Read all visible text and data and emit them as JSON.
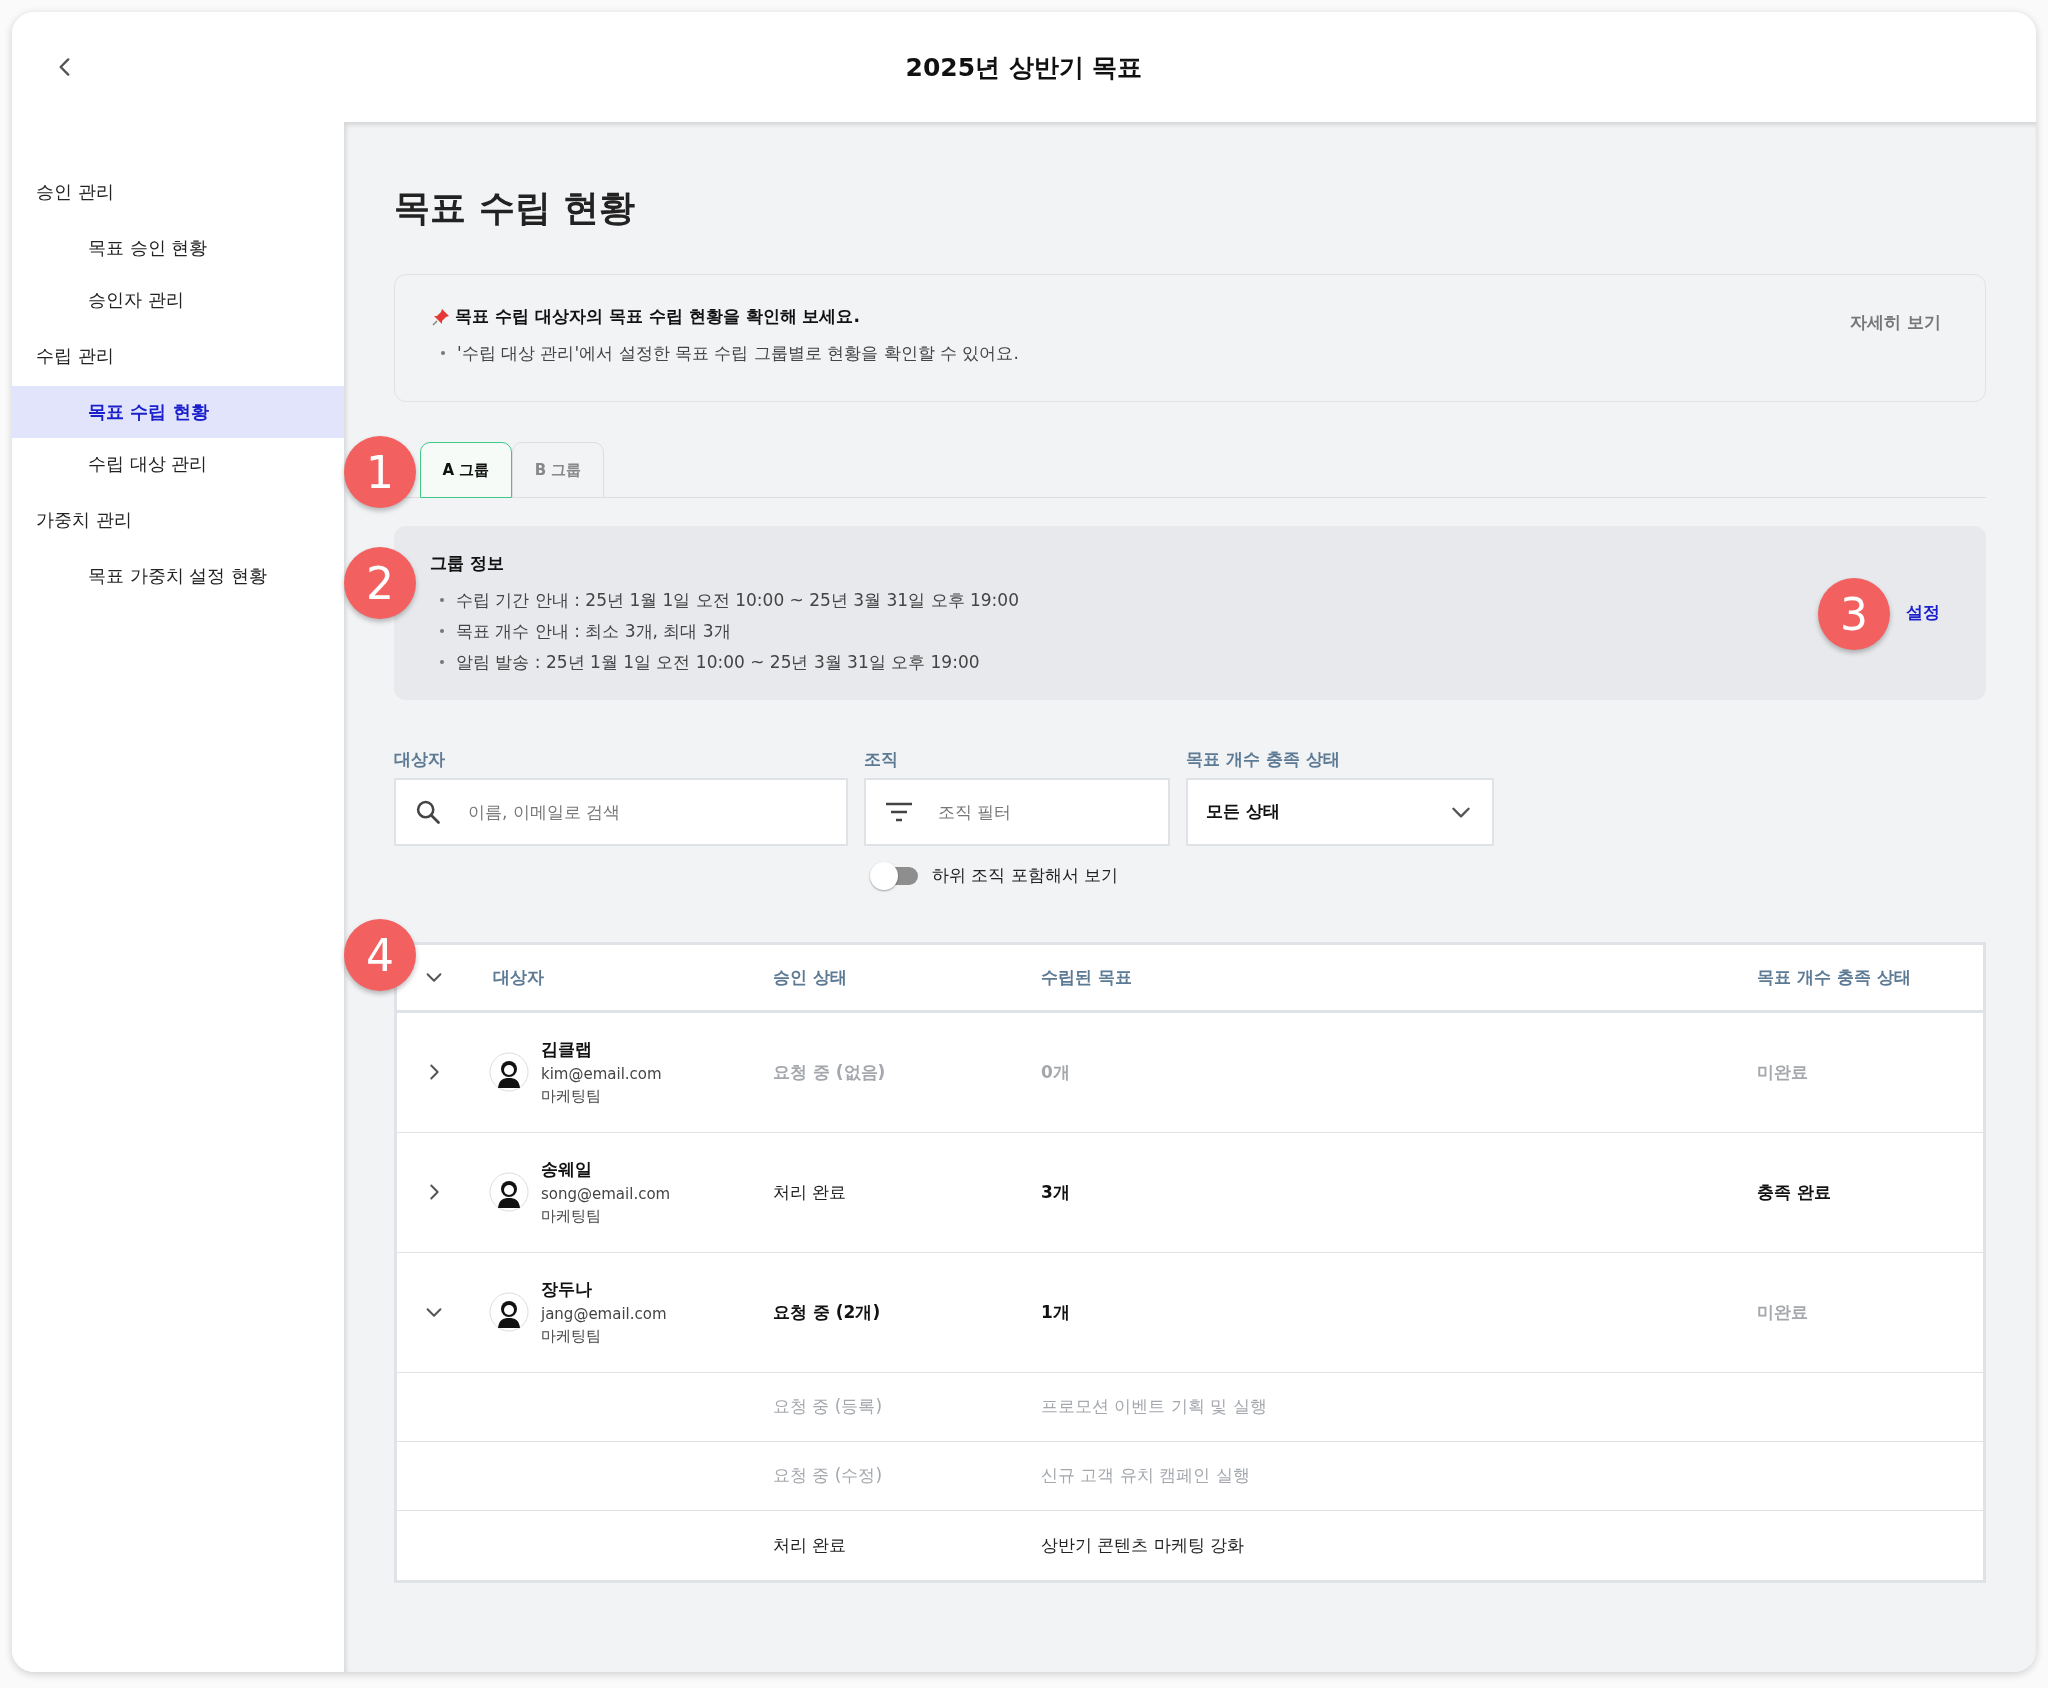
{
  "window": {
    "title": "2025년 상반기 목표"
  },
  "sidebar": {
    "sections": [
      {
        "label": "승인 관리",
        "children": [
          {
            "label": "목표 승인 현황",
            "selected": false
          },
          {
            "label": "승인자 관리",
            "selected": false
          }
        ]
      },
      {
        "label": "수립 관리",
        "children": [
          {
            "label": "목표 수립 현황",
            "selected": true
          },
          {
            "label": "수립 대상 관리",
            "selected": false
          }
        ]
      },
      {
        "label": "가중치 관리",
        "children": [
          {
            "label": "목표 가중치 설정 현황",
            "selected": false
          }
        ]
      }
    ]
  },
  "page_title": "목표 수립 현황",
  "notice": {
    "heading": "목표 수립 대상자의 목표 수립 현황을 확인해 보세요.",
    "bullets": [
      "'수립 대상 관리'에서 설정한 목표 수립 그룹별로 현황을 확인할 수 있어요."
    ],
    "link": "자세히 보기"
  },
  "tabs": [
    {
      "label": "A 그룹",
      "selected": true
    },
    {
      "label": "B 그룹",
      "selected": false
    }
  ],
  "group_info": {
    "heading": "그룹 정보",
    "bullets": [
      "수립 기간 안내 : 25년 1월 1일 오전 10:00 ~ 25년 3월 31일 오후 19:00",
      "목표 개수 안내 : 최소 3개, 최대 3개",
      "알림 발송 : 25년 1월 1일 오전 10:00 ~ 25년 3월 31일 오후 19:00"
    ],
    "link": "설정"
  },
  "filters": {
    "target": {
      "label": "대상자",
      "placeholder": "이름, 이메일로 검색"
    },
    "org": {
      "label": "조직",
      "placeholder": "조직 필터"
    },
    "status": {
      "label": "목표 개수 충족 상태",
      "value": "모든 상태"
    },
    "include_sub": {
      "label": "하위 조직 포함해서 보기",
      "on": false
    }
  },
  "table": {
    "all_expanded": true,
    "columns": [
      "대상자",
      "승인 상태",
      "수립된 목표",
      "목표 개수 충족 상태"
    ],
    "rows": [
      {
        "name": "김클랩",
        "email": "kim@email.com",
        "team": "마케팅팀",
        "approval": {
          "text": "요청 중 (없음)",
          "kind": "muted"
        },
        "goals": {
          "text": "0개",
          "kind": "muted"
        },
        "fulfillment": {
          "text": "미완료",
          "kind": "muted"
        },
        "expanded": false,
        "children": []
      },
      {
        "name": "송웨일",
        "email": "song@email.com",
        "team": "마케팅팀",
        "approval": {
          "text": "처리 완료",
          "kind": "normal"
        },
        "goals": {
          "text": "3개",
          "kind": "bold"
        },
        "fulfillment": {
          "text": "충족 완료",
          "kind": "bold"
        },
        "expanded": false,
        "children": []
      },
      {
        "name": "장두나",
        "email": "jang@email.com",
        "team": "마케팅팀",
        "approval": {
          "text": "요청 중 (2개)",
          "kind": "bold"
        },
        "goals": {
          "text": "1개",
          "kind": "bold"
        },
        "fulfillment": {
          "text": "미완료",
          "kind": "muted"
        },
        "expanded": true,
        "children": [
          {
            "approval": "요청 중 (등록)",
            "goal": "프로모션 이벤트 기획 및 실행",
            "kind": "muted"
          },
          {
            "approval": "요청 중 (수정)",
            "goal": "신규 고객 유치 캠페인 실행",
            "kind": "muted"
          },
          {
            "approval": "처리 완료",
            "goal": "상반기 콘텐츠 마케팅 강화",
            "kind": "normal"
          }
        ]
      }
    ]
  },
  "annotations": [
    "1",
    "2",
    "3",
    "4"
  ]
}
